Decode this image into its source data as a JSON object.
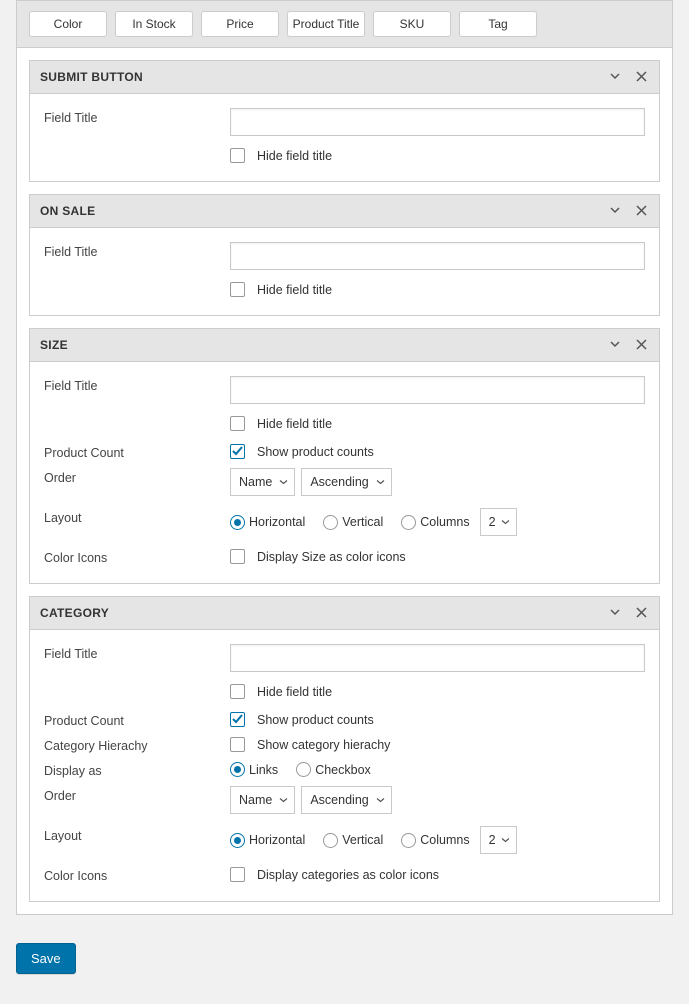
{
  "toolbar": {
    "buttons": [
      "Color",
      "In Stock",
      "Price",
      "Product Title",
      "SKU",
      "Tag"
    ]
  },
  "labels": {
    "field_title": "Field Title",
    "hide_field_title": "Hide field title",
    "product_count": "Product Count",
    "show_product_counts": "Show product counts",
    "order": "Order",
    "layout": "Layout",
    "color_icons": "Color Icons",
    "horizontal": "Horizontal",
    "vertical": "Vertical",
    "columns": "Columns",
    "category_hierarchy": "Category Hierachy",
    "show_category_hierarchy": "Show category hierachy",
    "display_as": "Display as",
    "links": "Links",
    "checkbox": "Checkbox"
  },
  "panels": {
    "submit": {
      "title": "SUBMIT BUTTON"
    },
    "onsale": {
      "title": "ON SALE"
    },
    "size": {
      "title": "SIZE",
      "order_by": "Name",
      "order_dir": "Ascending",
      "columns_value": "2",
      "color_icons_label": "Display Size as color icons"
    },
    "category": {
      "title": "CATEGORY",
      "order_by": "Name",
      "order_dir": "Ascending",
      "columns_value": "2",
      "color_icons_label": "Display categories as color icons"
    }
  },
  "footer": {
    "save": "Save"
  }
}
